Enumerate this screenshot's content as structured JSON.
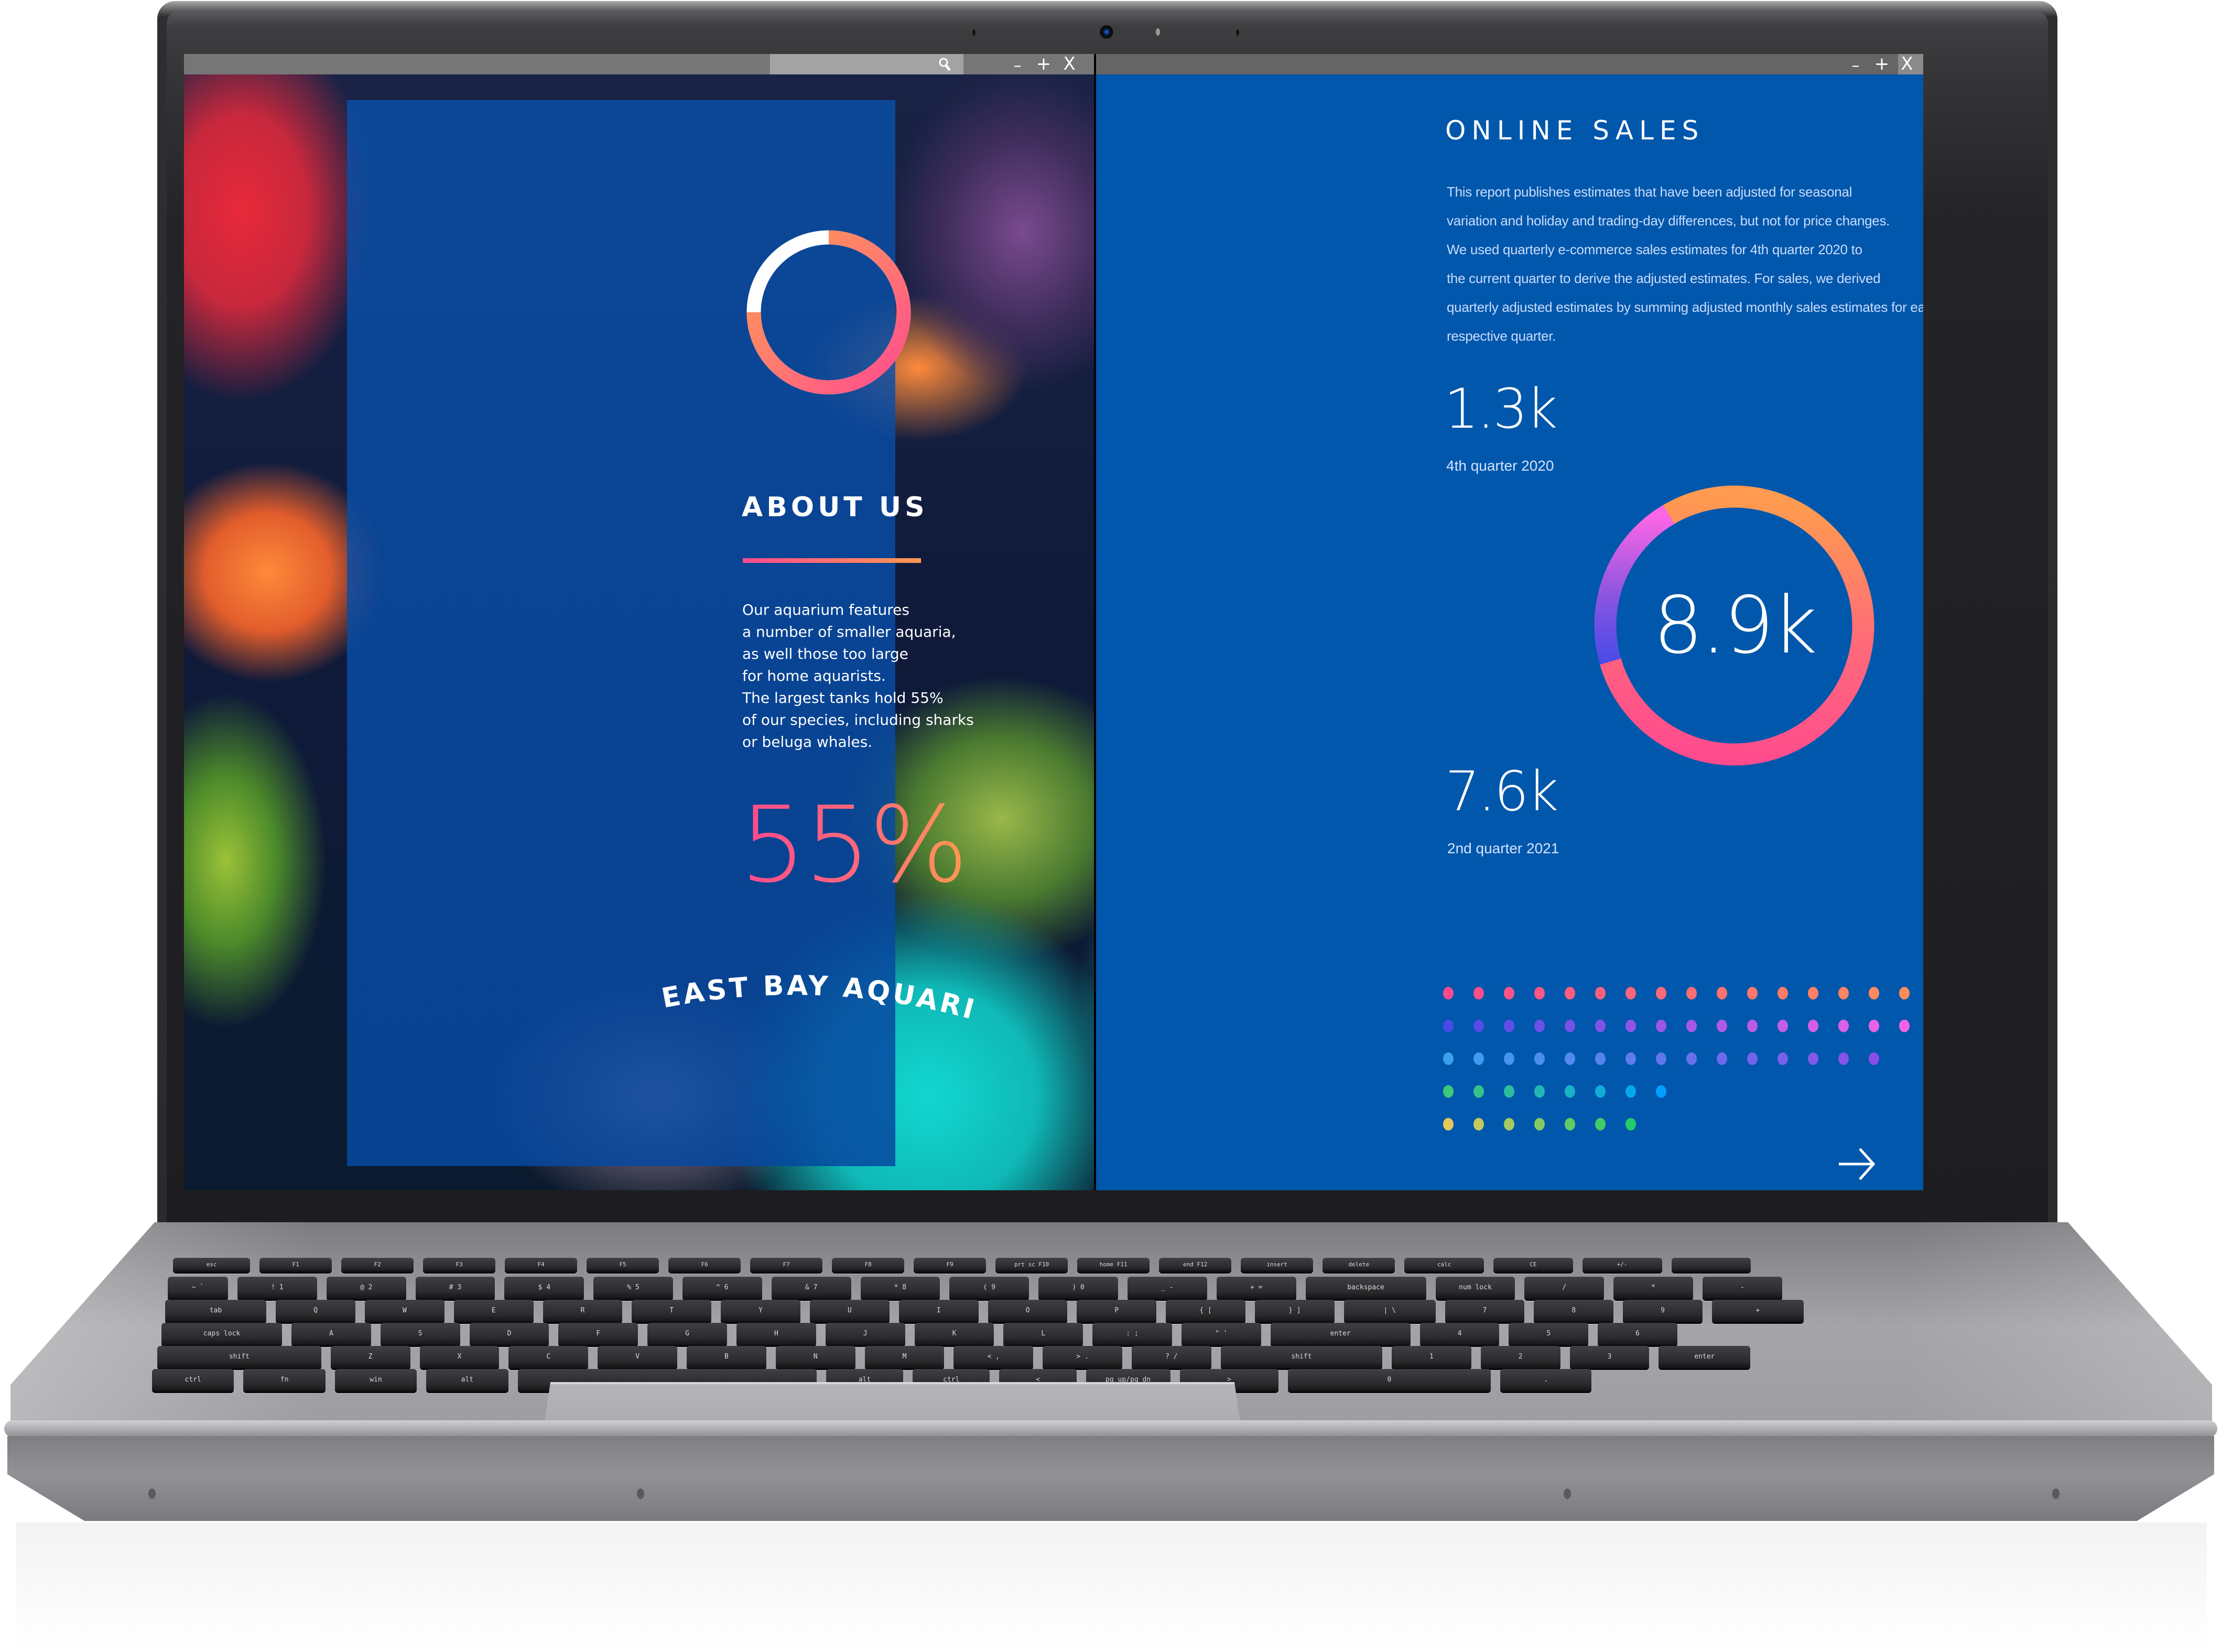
{
  "windows": {
    "left": {
      "search": {
        "placeholder": "",
        "icon": "search-icon"
      },
      "controls": {
        "minimize": "–",
        "maximize": "+",
        "close": "X"
      }
    },
    "right": {
      "search": {
        "placeholder": "",
        "icon": "search-icon"
      },
      "controls": {
        "minimize": "–",
        "maximize": "+",
        "close": "X"
      }
    }
  },
  "about": {
    "donut_fill_fraction": 0.75,
    "title": "ABOUT US",
    "body_lines": [
      "Our aquarium features",
      "a number of smaller aquaria,",
      "as well those too large",
      "for home aquarists.",
      "The largest tanks hold 55%",
      "of our species, including sharks",
      "or beluga whales."
    ],
    "highlight_stat": "55%",
    "brand": "EAST BAY AQUARIUM"
  },
  "sales": {
    "title": "ONLINE SALES",
    "body_lines": [
      "This report publishes estimates that have been adjusted for seasonal",
      "variation and holiday and trading-day differences, but not for price changes.",
      "We used quarterly e-commerce sales estimates for 4th quarter 2020 to",
      "the current quarter to derive the adjusted estimates. For sales, we derived",
      "quarterly adjusted estimates by summing adjusted monthly sales estimates for each",
      "respective quarter."
    ],
    "stats": [
      {
        "value": "1.3k",
        "label": "4th quarter 2020"
      },
      {
        "value": "7.6k",
        "label": "2nd quarter 2021"
      }
    ],
    "total": {
      "value": "8.9k",
      "ring_segments": [
        {
          "name": "orange-pink",
          "fraction": 0.79,
          "from": "#ff9a50",
          "to": "#ff4b8e"
        },
        {
          "name": "violet",
          "fraction": 0.21,
          "from": "#ff66e6",
          "to": "#4a4ae8"
        }
      ]
    },
    "dot_rows": [
      {
        "count": 19,
        "from": "#ff4b8e",
        "to": "#ff9a50"
      },
      {
        "count": 17,
        "from": "#4a4ae8",
        "to": "#ff66e6"
      },
      {
        "count": 15,
        "from": "#3aa0f0",
        "to": "#8a4ee8"
      },
      {
        "count": 8,
        "from": "#3ec97a",
        "to": "#00a0ff"
      },
      {
        "count": 7,
        "from": "#e6c85a",
        "to": "#22cc6a"
      }
    ],
    "next_icon": "arrow-right-icon"
  },
  "keyboard": {
    "rows": [
      [
        "esc",
        "F1",
        "F2",
        "F3",
        "F4",
        "F5",
        "F6",
        "F7",
        "F8",
        "F9",
        "prt sc F10",
        "home F11",
        "end F12",
        "insert",
        "delete",
        "calc",
        "CE",
        "+/-",
        ""
      ],
      [
        "~ `",
        "! 1",
        "@ 2",
        "# 3",
        "$ 4",
        "% 5",
        "^ 6",
        "& 7",
        "* 8",
        "( 9",
        ") 0",
        "_ -",
        "+ =",
        "backspace",
        "num lock",
        "/",
        "*",
        "-"
      ],
      [
        "tab",
        "Q",
        "W",
        "E",
        "R",
        "T",
        "Y",
        "U",
        "I",
        "O",
        "P",
        "{ [",
        "} ]",
        "| \\",
        "7",
        "8",
        "9",
        "+"
      ],
      [
        "caps lock",
        "A",
        "S",
        "D",
        "F",
        "G",
        "H",
        "J",
        "K",
        "L",
        ": ;",
        "\" '",
        "enter",
        "4",
        "5",
        "6"
      ],
      [
        "shift",
        "Z",
        "X",
        "C",
        "V",
        "B",
        "N",
        "M",
        "< ,",
        "> .",
        "? /",
        "shift",
        "1",
        "2",
        "3",
        "enter"
      ],
      [
        "ctrl",
        "fn",
        "win",
        "alt",
        "",
        "alt",
        "ctrl",
        "<",
        "pg up/pg dn",
        ">",
        "0",
        "."
      ]
    ]
  }
}
